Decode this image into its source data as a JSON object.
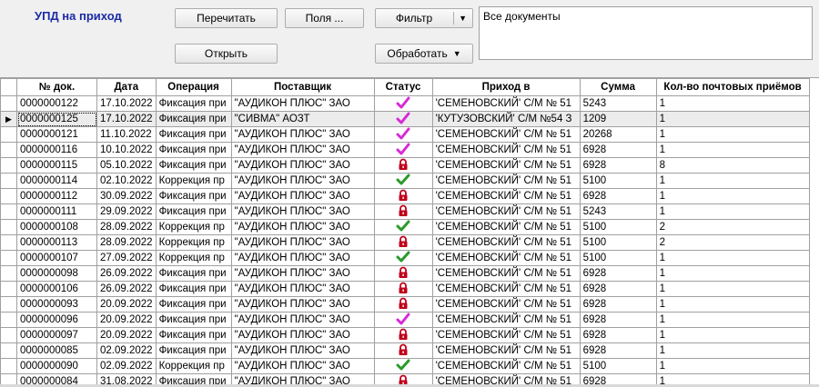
{
  "title": "УПД на приход",
  "toolbar": {
    "reread": "Перечитать",
    "fields": "Поля ...",
    "filter": "Фильтр",
    "open": "Открыть",
    "process": "Обработать"
  },
  "filter_text": "Все документы",
  "columns": [
    "№ док.",
    "Дата",
    "Операция",
    "Поставщик",
    "Статус",
    "Приход в",
    "Сумма",
    "Кол-во почтовых приёмов"
  ],
  "rows": [
    {
      "no": "0000000122",
      "date": "17.10.2022",
      "op": "Фиксация при",
      "supplier": "\"АУДИКОН ПЛЮС\" ЗАО",
      "status": "check-pink",
      "dest": "'СЕМЕНОВСКИЙ' С/М № 51",
      "sum": "5243",
      "count": "1"
    },
    {
      "no": "0000000125",
      "date": "17.10.2022",
      "op": "Фиксация при",
      "supplier": "\"СИВМА\" АОЗТ",
      "status": "check-pink",
      "dest": "'КУТУЗОВСКИЙ' С/М №54 З",
      "sum": "1209",
      "count": "1",
      "selected": true
    },
    {
      "no": "0000000121",
      "date": "11.10.2022",
      "op": "Фиксация при",
      "supplier": "\"АУДИКОН ПЛЮС\" ЗАО",
      "status": "check-pink",
      "dest": "'СЕМЕНОВСКИЙ' С/М № 51",
      "sum": "20268",
      "count": "1"
    },
    {
      "no": "0000000116",
      "date": "10.10.2022",
      "op": "Фиксация при",
      "supplier": "\"АУДИКОН ПЛЮС\" ЗАО",
      "status": "check-pink",
      "dest": "'СЕМЕНОВСКИЙ' С/М № 51",
      "sum": "6928",
      "count": "1"
    },
    {
      "no": "0000000115",
      "date": "05.10.2022",
      "op": "Фиксация при",
      "supplier": "\"АУДИКОН ПЛЮС\" ЗАО",
      "status": "lock",
      "dest": "'СЕМЕНОВСКИЙ' С/М № 51",
      "sum": "6928",
      "count": "8"
    },
    {
      "no": "0000000114",
      "date": "02.10.2022",
      "op": "Коррекция пр",
      "supplier": "\"АУДИКОН ПЛЮС\" ЗАО",
      "status": "check-green",
      "dest": "'СЕМЕНОВСКИЙ' С/М № 51",
      "sum": "5100",
      "count": "1"
    },
    {
      "no": "0000000112",
      "date": "30.09.2022",
      "op": "Фиксация при",
      "supplier": "\"АУДИКОН ПЛЮС\" ЗАО",
      "status": "lock",
      "dest": "'СЕМЕНОВСКИЙ' С/М № 51",
      "sum": "6928",
      "count": "1"
    },
    {
      "no": "0000000111",
      "date": "29.09.2022",
      "op": "Фиксация при",
      "supplier": "\"АУДИКОН ПЛЮС\" ЗАО",
      "status": "lock",
      "dest": "'СЕМЕНОВСКИЙ' С/М № 51",
      "sum": "5243",
      "count": "1"
    },
    {
      "no": "0000000108",
      "date": "28.09.2022",
      "op": "Коррекция пр",
      "supplier": "\"АУДИКОН ПЛЮС\" ЗАО",
      "status": "check-green",
      "dest": "'СЕМЕНОВСКИЙ' С/М № 51",
      "sum": "5100",
      "count": "2"
    },
    {
      "no": "0000000113",
      "date": "28.09.2022",
      "op": "Коррекция пр",
      "supplier": "\"АУДИКОН ПЛЮС\" ЗАО",
      "status": "lock",
      "dest": "'СЕМЕНОВСКИЙ' С/М № 51",
      "sum": "5100",
      "count": "2"
    },
    {
      "no": "0000000107",
      "date": "27.09.2022",
      "op": "Коррекция пр",
      "supplier": "\"АУДИКОН ПЛЮС\" ЗАО",
      "status": "check-green",
      "dest": "'СЕМЕНОВСКИЙ' С/М № 51",
      "sum": "5100",
      "count": "1"
    },
    {
      "no": "0000000098",
      "date": "26.09.2022",
      "op": "Фиксация при",
      "supplier": "\"АУДИКОН ПЛЮС\" ЗАО",
      "status": "lock",
      "dest": "'СЕМЕНОВСКИЙ' С/М № 51",
      "sum": "6928",
      "count": "1"
    },
    {
      "no": "0000000106",
      "date": "26.09.2022",
      "op": "Фиксация при",
      "supplier": "\"АУДИКОН ПЛЮС\" ЗАО",
      "status": "lock",
      "dest": "'СЕМЕНОВСКИЙ' С/М № 51",
      "sum": "6928",
      "count": "1"
    },
    {
      "no": "0000000093",
      "date": "20.09.2022",
      "op": "Фиксация при",
      "supplier": "\"АУДИКОН ПЛЮС\" ЗАО",
      "status": "lock",
      "dest": "'СЕМЕНОВСКИЙ' С/М № 51",
      "sum": "6928",
      "count": "1"
    },
    {
      "no": "0000000096",
      "date": "20.09.2022",
      "op": "Фиксация при",
      "supplier": "\"АУДИКОН ПЛЮС\" ЗАО",
      "status": "check-pink",
      "dest": "'СЕМЕНОВСКИЙ' С/М № 51",
      "sum": "6928",
      "count": "1"
    },
    {
      "no": "0000000097",
      "date": "20.09.2022",
      "op": "Фиксация при",
      "supplier": "\"АУДИКОН ПЛЮС\" ЗАО",
      "status": "lock",
      "dest": "'СЕМЕНОВСКИЙ' С/М № 51",
      "sum": "6928",
      "count": "1"
    },
    {
      "no": "0000000085",
      "date": "02.09.2022",
      "op": "Фиксация при",
      "supplier": "\"АУДИКОН ПЛЮС\" ЗАО",
      "status": "lock",
      "dest": "'СЕМЕНОВСКИЙ' С/М № 51",
      "sum": "6928",
      "count": "1"
    },
    {
      "no": "0000000090",
      "date": "02.09.2022",
      "op": "Коррекция пр",
      "supplier": "\"АУДИКОН ПЛЮС\" ЗАО",
      "status": "check-green",
      "dest": "'СЕМЕНОВСКИЙ' С/М № 51",
      "sum": "5100",
      "count": "1"
    },
    {
      "no": "0000000084",
      "date": "31.08.2022",
      "op": "Фиксация при",
      "supplier": "\"АУДИКОН ПЛЮС\" ЗАО",
      "status": "lock",
      "dest": "'СЕМЕНОВСКИЙ' С/М № 51",
      "sum": "6928",
      "count": "1"
    }
  ],
  "colors": {
    "title": "#1a2aa6",
    "check_pink": "#d62ad6",
    "check_green": "#2a9a2a",
    "lock": "#c0001a"
  }
}
